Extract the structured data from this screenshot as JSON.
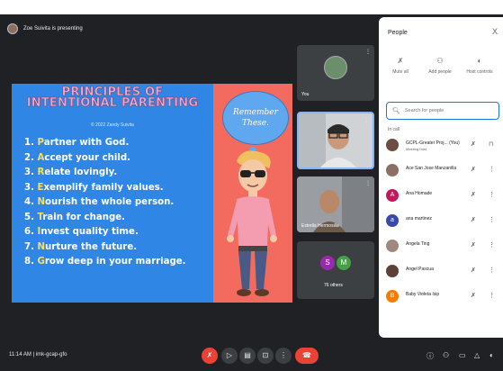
{
  "presenter": {
    "text": "Zoe Suivita is presenting"
  },
  "slide": {
    "title_line1": "PRINCIPLES OF",
    "title_line2": "INTENTIONAL PARENTING",
    "copyright": "© 2022 Zandy Suivita",
    "principles": [
      {
        "num": "1.",
        "first": "P",
        "rest": "artner with God."
      },
      {
        "num": "2.",
        "first": "A",
        "rest": "ccept your child."
      },
      {
        "num": "3.",
        "first": "R",
        "rest": "elate lovingly."
      },
      {
        "num": "3.",
        "first": "E",
        "rest": "xemplify family values."
      },
      {
        "num": "4.",
        "first": "N",
        "rest": "ourish the whole person."
      },
      {
        "num": "5.",
        "first": "T",
        "rest": "rain for change."
      },
      {
        "num": "6.",
        "first": "I",
        "rest": "nvest quality time."
      },
      {
        "num": "7.",
        "first": "N",
        "rest": "urture the future."
      },
      {
        "num": "8.",
        "first": "G",
        "rest": "row deep in your marriage."
      }
    ],
    "bubble_line1": "Remember",
    "bubble_line2": "These."
  },
  "tiles": {
    "you": "You",
    "tile3_name": "Estrella Hermosilla",
    "others_count": "76 others",
    "avatar_s": "S",
    "avatar_m": "M"
  },
  "panel": {
    "title": "People",
    "close": "X",
    "actions": [
      {
        "icon": "mute-all-icon",
        "glyph": "✗",
        "label": "Mute all"
      },
      {
        "icon": "add-people-icon",
        "glyph": "⚇",
        "label": "Add people"
      },
      {
        "icon": "host-controls-icon",
        "glyph": "◐",
        "label": "Host controls"
      }
    ],
    "search_placeholder": "Search for people",
    "in_call": "In call",
    "people": [
      {
        "name": "GCPL-Greater Proj... (You)",
        "sub": "Meeting host",
        "color": "#6d4c41"
      },
      {
        "name": "Ace San Jose Manzanilla",
        "sub": "",
        "color": "#8d6e63"
      },
      {
        "name": "Ana Homade",
        "sub": "",
        "color": "#c2185b",
        "initial": "A"
      },
      {
        "name": "ana martinez",
        "sub": "",
        "color": "#3949ab",
        "initial": "a"
      },
      {
        "name": "Angela Ting",
        "sub": "",
        "color": "#a1887f"
      },
      {
        "name": "Angel Pascua",
        "sub": "",
        "color": "#5d4037"
      },
      {
        "name": "Baby Violeta Isip",
        "sub": "",
        "color": "#f57c00",
        "initial": "B"
      }
    ]
  },
  "bottom": {
    "meeting_info": "11:14 AM  |  imk-gcap-gfo"
  }
}
